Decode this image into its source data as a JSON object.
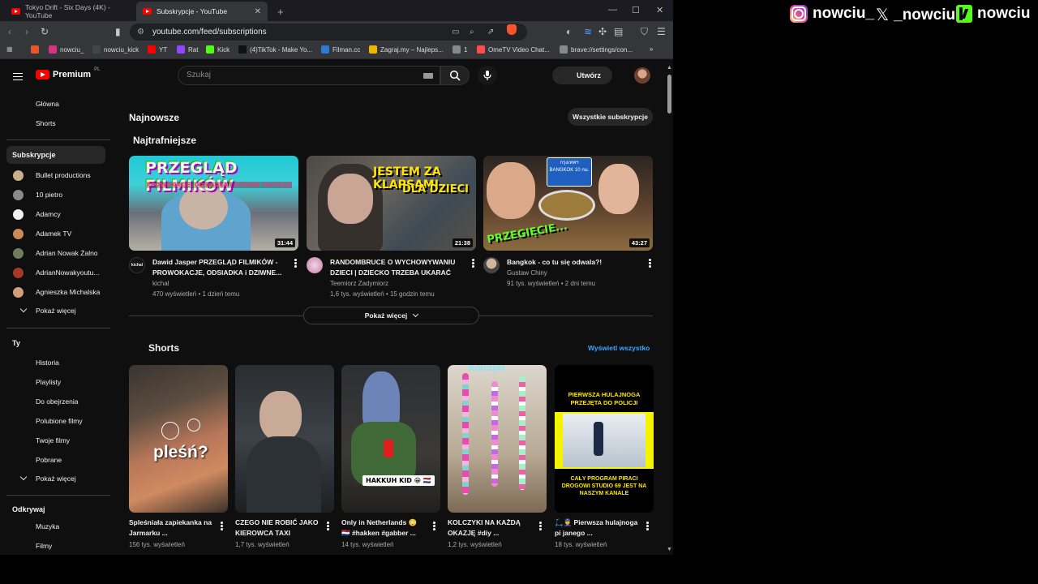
{
  "browser": {
    "tabs": [
      {
        "title": "Tokyo Drift - Six Days (4K) - YouTube",
        "active": false
      },
      {
        "title": "Subskrypcje - YouTube",
        "active": true
      }
    ],
    "new_tab": "+",
    "address": "youtube.com/feed/subscriptions",
    "bookmarks": [
      {
        "label": "",
        "icon": "orange-bookmark-icon",
        "color": "#e8572a"
      },
      {
        "label": "nowciu_",
        "icon": "instagram-icon",
        "color": "#d63384"
      },
      {
        "label": "nowciu_kick",
        "icon": "x-icon",
        "color": "#444444"
      },
      {
        "label": "YT",
        "icon": "youtube-icon",
        "color": "#ff0000"
      },
      {
        "label": "Rat",
        "icon": "twitch-icon",
        "color": "#9146ff"
      },
      {
        "label": "Kick",
        "icon": "kick-icon",
        "color": "#53fc18"
      },
      {
        "label": "(4)TikTok - Make Yo...",
        "icon": "tiktok-icon",
        "color": "#111111"
      },
      {
        "label": "Filman.cc",
        "icon": "filman-icon",
        "color": "#2f7ad6"
      },
      {
        "label": "Zagraj.my – Najleps...",
        "icon": "zagraj-icon",
        "color": "#f0b400"
      },
      {
        "label": "1",
        "icon": "globe-icon",
        "color": "#888888"
      },
      {
        "label": "OmeTV Video Chat...",
        "icon": "ometv-icon",
        "color": "#ff4d4d"
      },
      {
        "label": "brave://settings/con...",
        "icon": "settings-icon",
        "color": "#888888"
      }
    ],
    "bookmarks_overflow": "»"
  },
  "youtube": {
    "logo_text": "Premium",
    "logo_region": "PL",
    "search_placeholder": "Szukaj",
    "create_label": "Utwórz",
    "sidebar": {
      "main": [
        "Główna",
        "Shorts"
      ],
      "subscriptions_title": "Subskrypcje",
      "channels": [
        {
          "name": "Bullet productions",
          "color": "#c9b28a"
        },
        {
          "name": "10 pietro",
          "color": "#8a8a8a"
        },
        {
          "name": "Adamcy",
          "color": "#f2f2f2"
        },
        {
          "name": "Adamek TV",
          "color": "#c98b5a"
        },
        {
          "name": "Adrian Nowak Żalno",
          "color": "#6f7d5c"
        },
        {
          "name": "AdrianNowakyoutu...",
          "color": "#a33a2a"
        },
        {
          "name": "Agnieszka Michalska",
          "color": "#d0a07a"
        }
      ],
      "show_more_1": "Pokaż więcej",
      "you_title": "Ty",
      "you_items": [
        "Historia",
        "Playlisty",
        "Do obejrzenia",
        "Polubione filmy",
        "Twoje filmy",
        "Pobrane"
      ],
      "show_more_2": "Pokaż więcej",
      "explore_title": "Odkrywaj",
      "explore_items": [
        "Muzyka",
        "Filmy"
      ]
    },
    "latest_title": "Najnowsze",
    "all_subs_label": "Wszystkie subskrypcje",
    "relevant_title": "Najtrafniejsze",
    "videos": [
      {
        "title": "Dawid Jasper PRZEGLĄD FILMIKÓW - PROWOKACJE, ODSIADKA i DZIWNE...",
        "channel": "kichal",
        "meta": "470 wyświetleń • 1 dzień temu",
        "duration": "31:44",
        "thumb_text": "PRZEGLĄD FILMIKÓW",
        "thumb_sub": "PROWOKACJE, ODSIADKA I DZIWNE FANTAZJE",
        "avatar_text": "kichal"
      },
      {
        "title": "RANDOMBRUCE O WYCHOWYWANIU DZIECI | DZIECKO TRZEBA UKARAĆ",
        "channel": "Teemiorz Zadymiorz",
        "meta": "1,6 tys. wyświetleń • 15 godzin temu",
        "duration": "21:38",
        "thumb_text": "JESTEM ZA KLAPSAMI",
        "thumb_sub": "DLA DZIECI",
        "avatar_text": ""
      },
      {
        "title": "Bangkok - co tu się odwala?!",
        "channel": "Gustaw Chiny",
        "meta": "91 tys. wyświetleń • 2 dni temu",
        "duration": "43:27",
        "thumb_text": "PRZEGIĘCIE...",
        "thumb_sub": "กรุงเทพฯ BANGKOK 10 กม.",
        "avatar_text": ""
      }
    ],
    "show_more_label": "Pokaż więcej",
    "shorts_title": "Shorts",
    "view_all_label": "Wyświetl wszystko",
    "shorts": [
      {
        "title": "Spleśniała zapiekanka na Jarmarku ...",
        "views": "156 tys. wyświetleń",
        "thumb_text": "pleśń?"
      },
      {
        "title": "CZEGO NIE ROBIĆ JAKO KIEROWCA TAXI",
        "views": "1,7 tys. wyświetleń",
        "thumb_text": ""
      },
      {
        "title": "Only in Netherlands 😳 🇳🇱 #hakken #gabber ...",
        "views": "14 tys. wyświetleń",
        "thumb_text": "HAKKUH KID 😁 🇳🇱"
      },
      {
        "title": "KOLCZYKI NA KAŻDĄ OKAZJĘ #diy ...",
        "views": "1,2 tys. wyświetleń",
        "thumb_text": "Kolczyki"
      },
      {
        "title": "🛴👮 Pierwsza hulajnoga pi janego ...",
        "views": "18 tys. wyświetleń",
        "thumb_text": "PIERWSZA HULAJNOGA PRZEJĘTA DO POLICJI",
        "thumb_sub": "CAŁY PROGRAM PIRACI DROGOWI STUDIO 69 JEST NA NASZYM KANALE"
      }
    ]
  },
  "overlay": {
    "instagram": "nowciu_",
    "x": "_nowciu",
    "kick": "nowciu"
  }
}
